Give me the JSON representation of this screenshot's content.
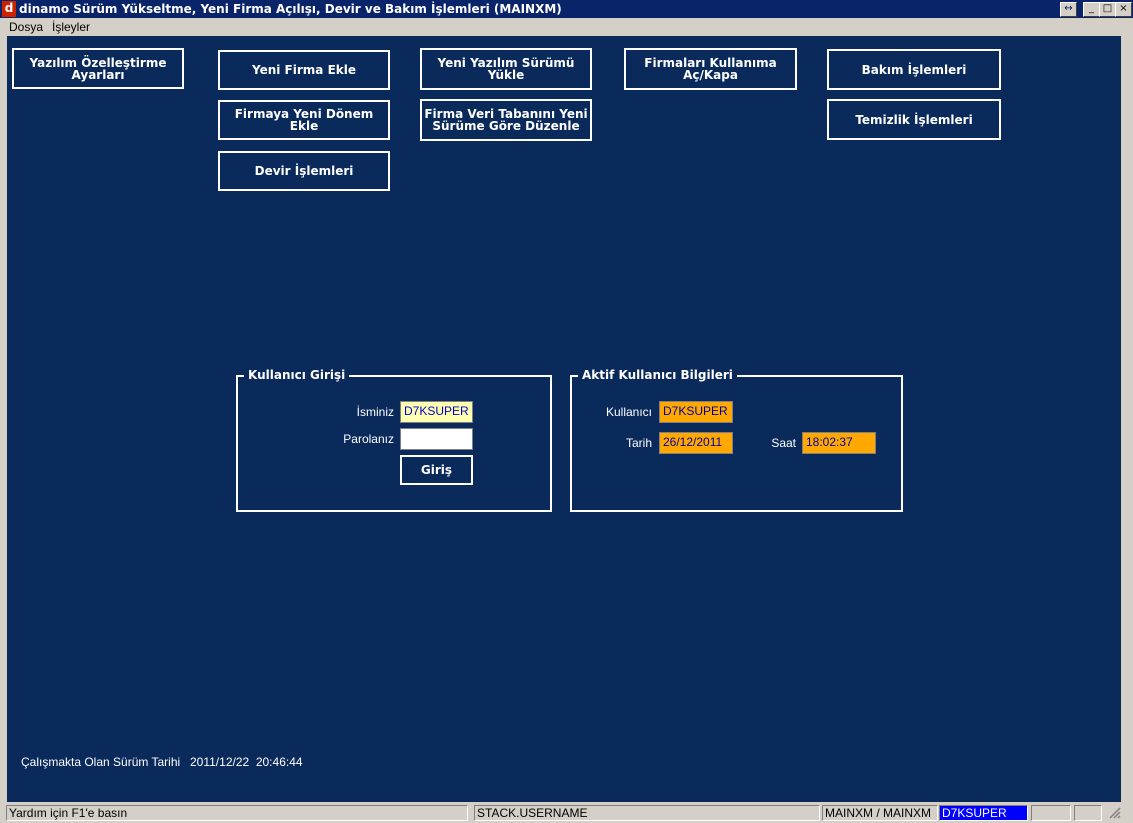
{
  "window": {
    "title": "dinamo Sürüm Yükseltme, Yeni Firma Açılışı, Devir ve Bakım İşlemleri (MAINXM)",
    "icon_letter": "d",
    "controls": {
      "resize": "↔",
      "minimize": "_",
      "maximize": "□",
      "close": "×"
    }
  },
  "menu": {
    "items": [
      "Dosya",
      "İşleyler"
    ]
  },
  "buttons": {
    "yazilim_ozellestirme": "Yazılım Özelleştirme\nAyarları",
    "yeni_firma_ekle": "Yeni Firma Ekle",
    "firmaya_yeni_donem_ekle": "Firmaya Yeni Dönem Ekle",
    "devir_islemleri": "Devir İşlemleri",
    "yeni_yazilim_surumu_yukle": "Yeni Yazılım Sürümü\nYükle",
    "firma_veri_tabani_duzenle": "Firma Veri Tabanını Yeni\nSürüme Göre Düzenle",
    "firmalari_kullanima_ac_kapa": "Firmaları Kullanıma\nAç/Kapa",
    "bakim_islemleri": "Bakım İşlemleri",
    "temizlik_islemleri": "Temizlik İşlemleri"
  },
  "login": {
    "legend": "Kullanıcı Girişi",
    "name_label": "İsminiz",
    "name_value": "D7KSUPER",
    "password_label": "Parolanız",
    "password_value": "",
    "submit_label": "Giriş"
  },
  "active_user": {
    "legend": "Aktif Kullanıcı Bilgileri",
    "user_label": "Kullanıcı",
    "user_value": "D7KSUPER",
    "date_label": "Tarih",
    "date_value": "26/12/2011",
    "time_label": "Saat",
    "time_value": "18:02:37"
  },
  "version_info": {
    "label": "Çalışmakta Olan Sürüm Tarihi",
    "value": "2011/12/22  20:46:44"
  },
  "statusbar": {
    "help": "Yardım için F1'e basın",
    "username": "STACK.USERNAME",
    "db": "MAINXM / MAINXM",
    "user": "D7KSUPER"
  },
  "colors": {
    "background": "#0b2a5c",
    "titlebar": "#0a246a",
    "field_yellow": "#ffffb0",
    "field_orange": "#ffa800",
    "status_highlight": "#0000ff"
  }
}
